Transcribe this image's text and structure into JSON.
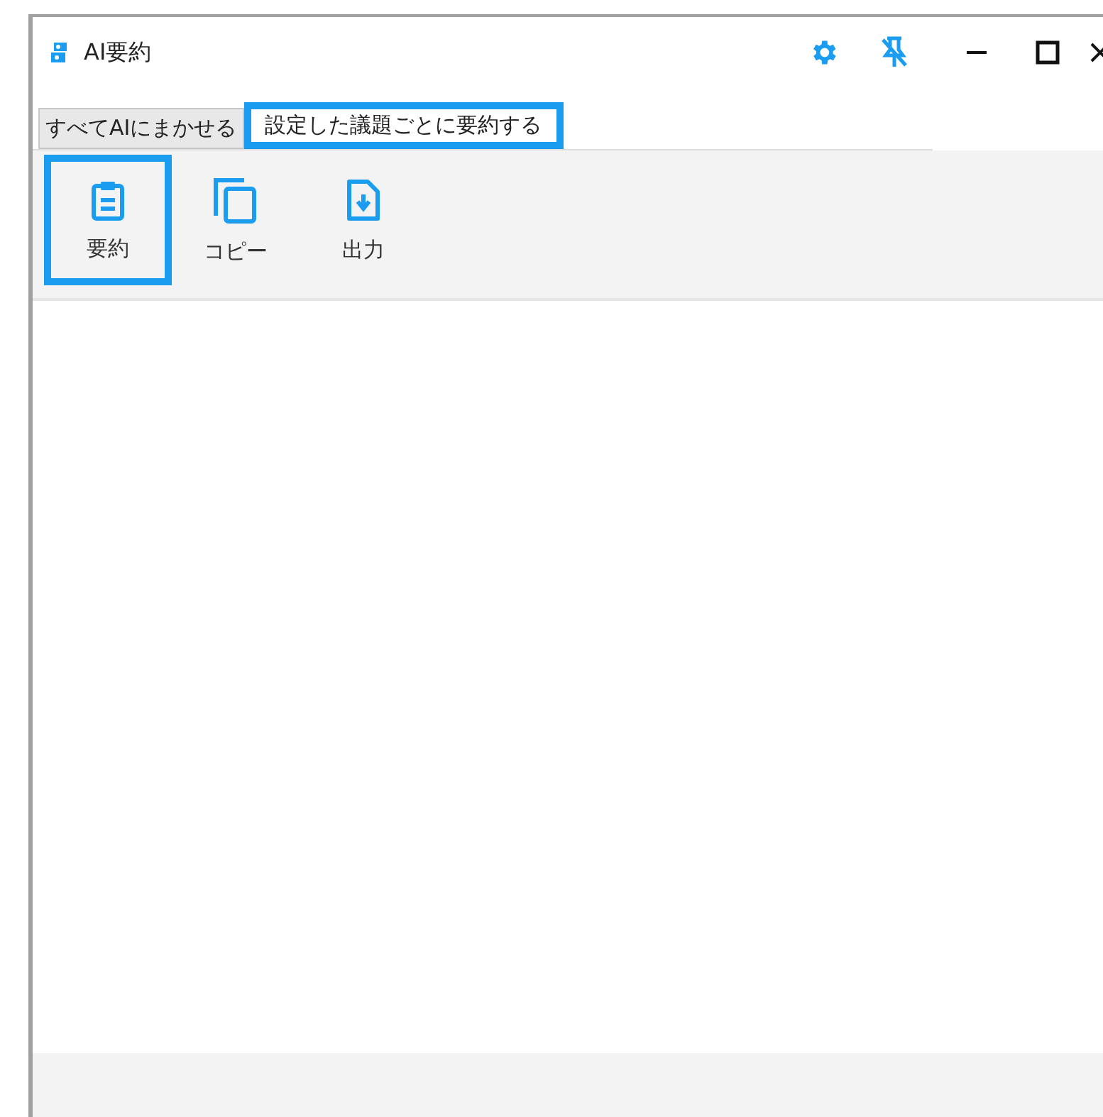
{
  "window": {
    "title": "AI要約"
  },
  "tabs": [
    {
      "label": "すべてAIにまかせる",
      "selected": false,
      "highlighted": false
    },
    {
      "label": "設定した議題ごとに要約する",
      "selected": true,
      "highlighted": true
    }
  ],
  "toolbar": [
    {
      "kind": "summary",
      "label": "要約",
      "highlighted": true
    },
    {
      "kind": "copy",
      "label": "コピー",
      "highlighted": false
    },
    {
      "kind": "export",
      "label": "出力",
      "highlighted": false
    }
  ]
}
